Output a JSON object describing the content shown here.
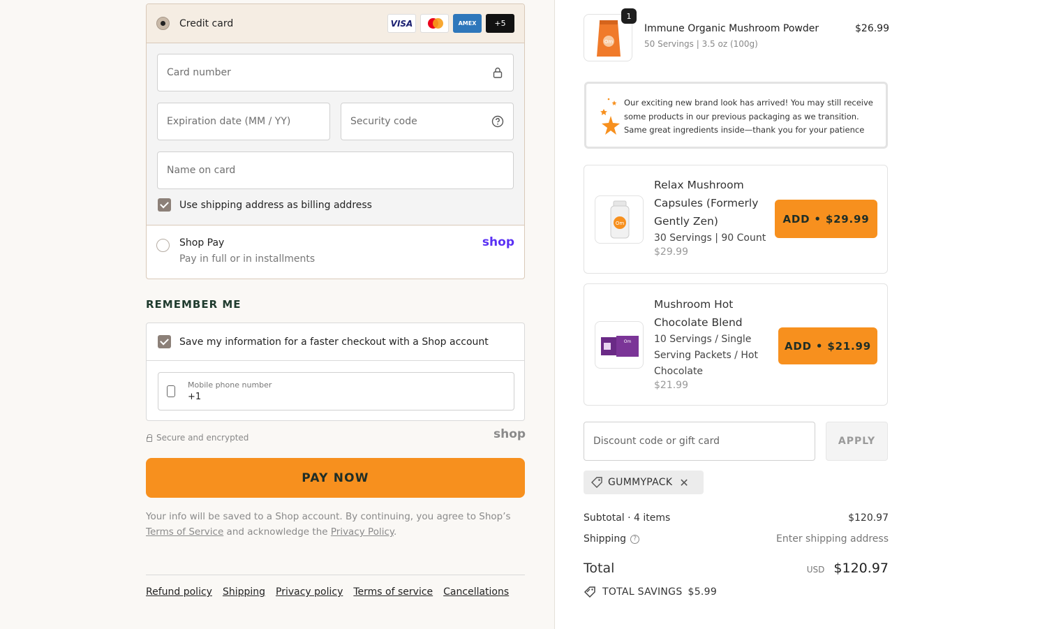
{
  "payment": {
    "credit_card_label": "Credit card",
    "card_logos": [
      "VISA",
      "AMEX",
      "+5"
    ],
    "card_number_placeholder": "Card number",
    "expiration_placeholder": "Expiration date (MM / YY)",
    "security_code_placeholder": "Security code",
    "name_on_card_placeholder": "Name on card",
    "billing_same_label": "Use shipping address as billing address",
    "shop_pay_title": "Shop Pay",
    "shop_pay_subtitle": "Pay in full or in installments",
    "shop_pay_logo": "shop"
  },
  "remember": {
    "heading": "REMEMBER ME",
    "save_info_label": "Save my information for a faster checkout with a Shop account",
    "phone_label": "Mobile phone number",
    "phone_value": "+1"
  },
  "secure_text": "Secure and encrypted",
  "shop_logo_gray": "shop",
  "pay_now_label": "PAY NOW",
  "legal": {
    "prefix": "Your info will be saved to a Shop account. By continuing, you agree to Shop’s",
    "terms_link": "Terms of Service",
    "middle": "and acknowledge the",
    "privacy_link": "Privacy Policy",
    "suffix": "."
  },
  "footer_links": [
    "Refund policy",
    "Shipping",
    "Privacy policy",
    "Terms of service",
    "Cancellations"
  ],
  "cart": {
    "item": {
      "quantity": "1",
      "name": "Immune Organic Mushroom Powder",
      "variant": "50 Servings | 3.5 oz (100g)",
      "price": "$26.99",
      "thumb_text": "Om"
    },
    "notice": {
      "line1": "Our exciting new brand look has arrived! You may still receive",
      "line2": "some products in our previous packaging as we transition.",
      "line3": "Same great ingredients inside—thank you for your patience"
    },
    "upsells": [
      {
        "title_lines": [
          "Relax Mushroom",
          "Capsules (Formerly",
          "Gently Zen)"
        ],
        "sub_lines": [
          "30 Servings | 90 Count"
        ],
        "price": "$29.99",
        "button": "ADD • $29.99",
        "thumb_text": "Om"
      },
      {
        "title_lines": [
          "Mushroom Hot",
          "Chocolate Blend"
        ],
        "sub_lines": [
          "10 Servings / Single",
          "Serving Packets / Hot",
          "Chocolate"
        ],
        "price": "$21.99",
        "button": "ADD • $21.99",
        "thumb_text": "Om"
      }
    ],
    "discount_placeholder": "Discount code or gift card",
    "apply_label": "APPLY",
    "applied_code": "GUMMYPACK",
    "subtotal_label": "Subtotal · 4 items",
    "subtotal_value": "$120.97",
    "shipping_label": "Shipping",
    "shipping_value": "Enter shipping address",
    "total_label": "Total",
    "currency": "USD",
    "total_value": "$120.97",
    "savings_label": "TOTAL SAVINGS",
    "savings_value": "$5.99"
  },
  "colors": {
    "accent_orange": "#f7901e",
    "shop_purple": "#5a31f4",
    "heading_green": "#1f3b2e"
  }
}
